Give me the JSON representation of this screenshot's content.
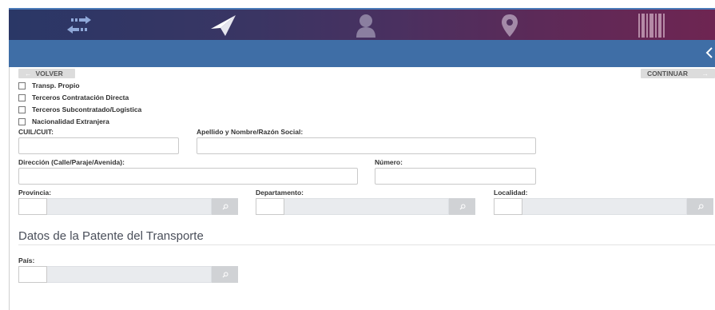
{
  "nav": {
    "icons": [
      "transfer-icon",
      "send-icon",
      "user-icon",
      "location-pin-icon",
      "barcode-icon"
    ]
  },
  "buttons": {
    "back_label": "VOLVER",
    "back_arrow": "←",
    "next_label": "CONTINUAR",
    "next_arrow": "→"
  },
  "transport_options": [
    "Transp. Propio",
    "Terceros Contratación Directa",
    "Terceros Subcontratado/Logística",
    "Nacionalidad Extranjera"
  ],
  "fields": {
    "cuil_label": "CUIL/CUIT:",
    "name_label": "Apellido y Nombre/Razón Social:",
    "address_label": "Dirección (Calle/Paraje/Avenida):",
    "number_label": "Número:",
    "province_label": "Provincia:",
    "department_label": "Departamento:",
    "locality_label": "Localidad:"
  },
  "plate_section": {
    "title": "Datos de la Patente del Transporte",
    "country_label": "País:"
  },
  "colors": {
    "header_gradient_start": "#2a3766",
    "header_gradient_end": "#6e2552",
    "subbar": "#3f6ea6",
    "button_bg": "#dcdcdc"
  }
}
